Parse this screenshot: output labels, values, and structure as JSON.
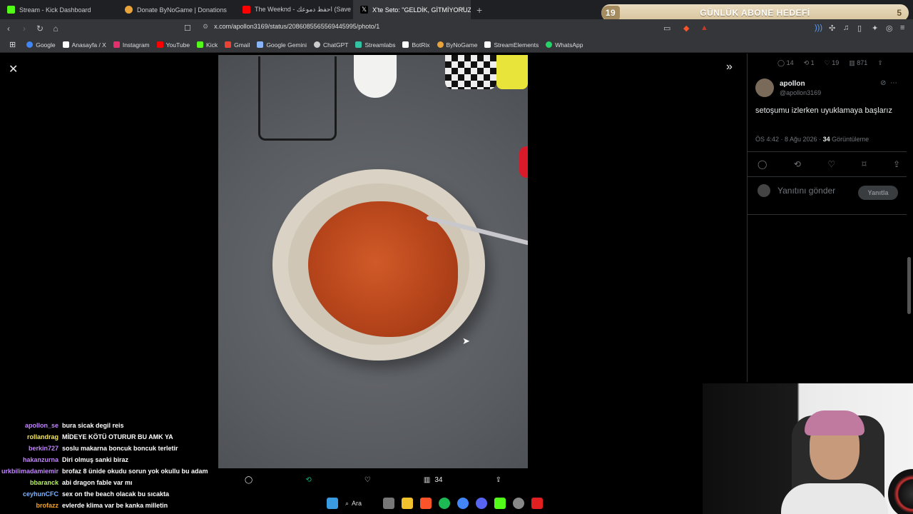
{
  "tabs": [
    {
      "title": "Stream - Kick Dashboard",
      "color": "#53fc18",
      "active": false
    },
    {
      "title": "Donate ByNoGame | Donations",
      "color": "#e8a33a",
      "active": false
    },
    {
      "title": "The Weeknd - احفظ دموعك (Save",
      "color": "#ff0000",
      "active": false
    },
    {
      "title": "X'te Seto: \"GELDİK, GİTMİYORUZ",
      "color": "#ffffff",
      "active": true
    }
  ],
  "goal": {
    "left": "19",
    "label": "GÜNLÜK ABONE HEDEFİ",
    "right": "5"
  },
  "url": "x.com/apollon3169/status/2086085565569445995/photo/1",
  "bookmarks": [
    {
      "label": "Google",
      "color": "#4285f4"
    },
    {
      "label": "Anasayfa / X",
      "color": "#ffffff"
    },
    {
      "label": "Instagram",
      "color": "#e1306c"
    },
    {
      "label": "YouTube",
      "color": "#ff0000"
    },
    {
      "label": "Kick",
      "color": "#53fc18"
    },
    {
      "label": "Gmail",
      "color": "#ea4335"
    },
    {
      "label": "Google Gemini",
      "color": "#8ab4f8"
    },
    {
      "label": "ChatGPT",
      "color": "#cccccc"
    },
    {
      "label": "Streamlabs",
      "color": "#31c3a2"
    },
    {
      "label": "BotRix",
      "color": "#ffffff"
    },
    {
      "label": "ByNoGame",
      "color": "#e8a33a"
    },
    {
      "label": "StreamElements",
      "color": "#ffffff"
    },
    {
      "label": "WhatsApp",
      "color": "#25d366"
    }
  ],
  "photo_actions": {
    "views": "34"
  },
  "tweet": {
    "stats": {
      "replies": "14",
      "retweets": "1",
      "likes": "19",
      "views": "871"
    },
    "author_name": "apollon",
    "author_handle": "@apollon3169",
    "text": "setoşumu izlerken uyuklamaya başlarız",
    "time": "ÖS 4:42 · 8 Ağu 2026 · ",
    "views_count": "34",
    "views_label": " Görüntüleme",
    "reply_placeholder": "Yanıtını gönder",
    "reply_button": "Yanıtla"
  },
  "chat": [
    {
      "user": "apollon_se",
      "color": "#c084fc",
      "msg": "bura sicak degil reis"
    },
    {
      "user": "rollandrag",
      "color": "#f5e663",
      "msg": "MİDEYE KÖTÜ OTURUR BU AMK YA"
    },
    {
      "user": "berkin727",
      "color": "#c084fc",
      "msg": "soslu makarna boncuk boncuk terletir"
    },
    {
      "user": "hakanzurna",
      "color": "#c084fc",
      "msg": "Diri olmuş sanki biraz"
    },
    {
      "user": "urkbilimadamiemir",
      "color": "#c084fc",
      "msg": "brofaz 8 ünide okudu sorun yok okullu bu adam"
    },
    {
      "user": "bbaranck",
      "color": "#b9f06a",
      "msg": "abi dragon fable var mı"
    },
    {
      "user": "ceyhunCFC",
      "color": "#7fb2ff",
      "msg": "sex on the beach olacak bu sıcakta"
    },
    {
      "user": "brofazz",
      "color": "#f5a524",
      "msg": "evlerde klima var be kanka milletin"
    }
  ],
  "taskbar": {
    "search_label": "Ara"
  }
}
